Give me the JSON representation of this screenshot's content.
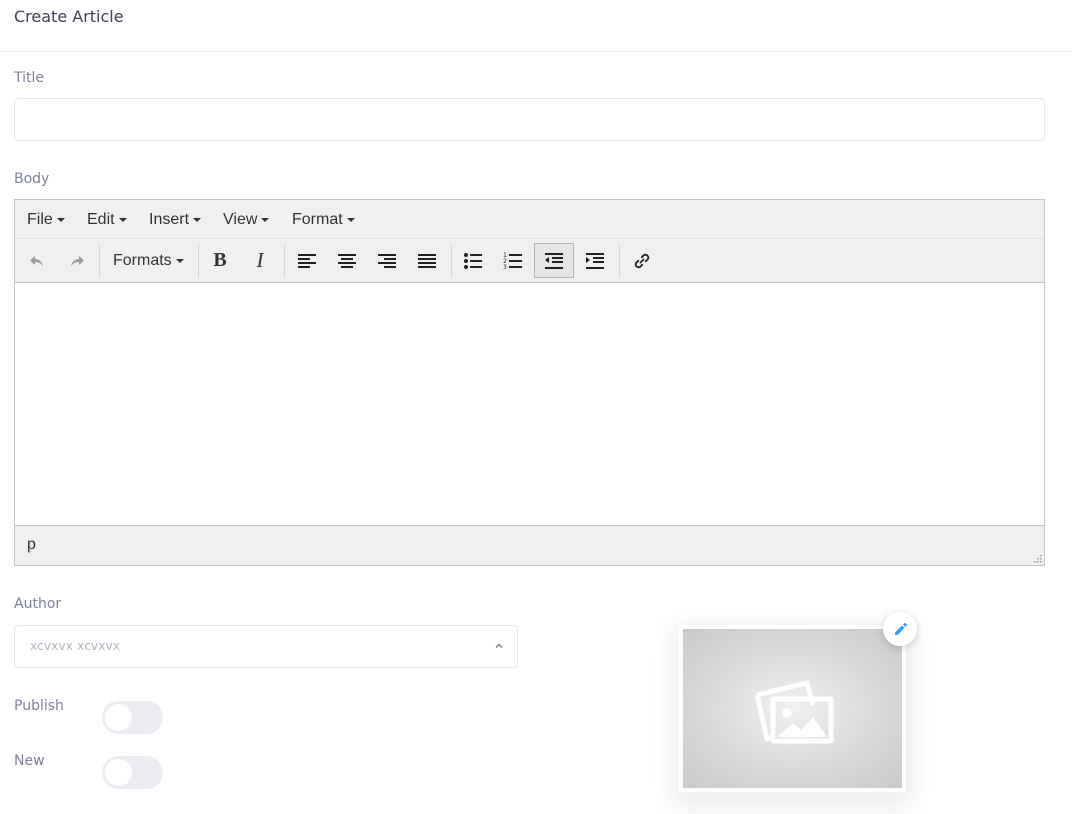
{
  "page": {
    "title": "Create Article"
  },
  "labels": {
    "title": "Title",
    "body": "Body",
    "author": "Author",
    "publish": "Publish",
    "new": "New"
  },
  "title_input": {
    "value": "",
    "placeholder": ""
  },
  "editor": {
    "menu": [
      "File",
      "Edit",
      "Insert",
      "View",
      "Format"
    ],
    "formats_label": "Formats",
    "toolbar_icons": [
      "undo-icon",
      "redo-icon",
      "bold-icon",
      "italic-icon",
      "align-left-icon",
      "align-center-icon",
      "align-right-icon",
      "align-justify-icon",
      "bullet-list-icon",
      "numbered-list-icon",
      "outdent-icon",
      "indent-icon",
      "link-icon"
    ],
    "active_button": "outdent-icon",
    "content": "",
    "status_path": "p"
  },
  "author": {
    "selected": "xcvxvx xcvxvx"
  },
  "toggles": {
    "publish": false,
    "new": false
  },
  "image": {
    "placeholder_icon": "image-placeholder-icon",
    "edit_icon": "pencil-icon"
  },
  "colors": {
    "accent": "#3699ff",
    "label": "#7e8299",
    "toggle_off": "#ebedf3"
  }
}
